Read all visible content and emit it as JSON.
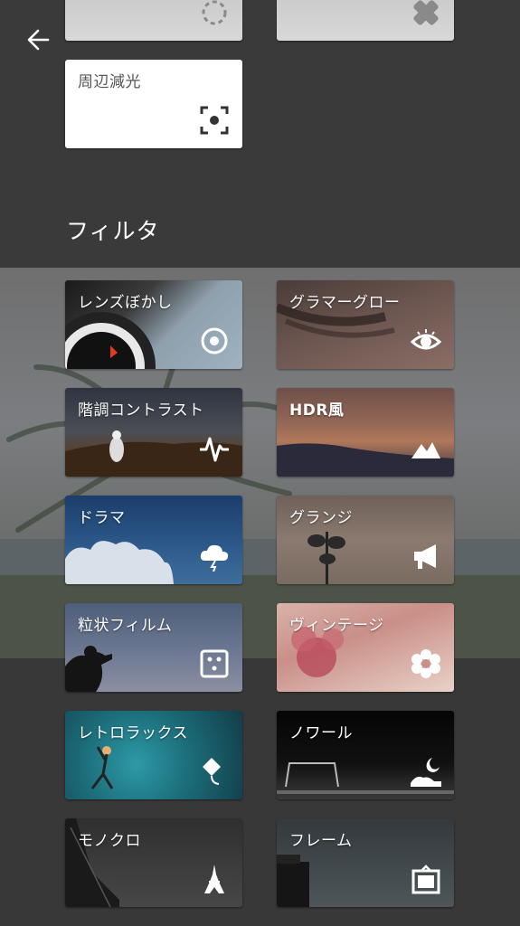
{
  "header": {
    "back_icon": "arrow-left-icon"
  },
  "tools_partial": [
    {
      "icon": "dashed-circle-icon"
    },
    {
      "icon": "healing-bandage-icon"
    }
  ],
  "vignette_tool": {
    "label": "周辺減光",
    "icon": "vignette-focus-icon"
  },
  "section": {
    "title": "フィルタ"
  },
  "filters": [
    {
      "label": "レンズぼかし",
      "icon": "target-circle-icon"
    },
    {
      "label": "グラマーグロー",
      "icon": "eye-icon"
    },
    {
      "label": "階調コントラスト",
      "icon": "pulse-icon"
    },
    {
      "label": "HDR風",
      "icon": "mountains-icon"
    },
    {
      "label": "ドラマ",
      "icon": "storm-cloud-icon"
    },
    {
      "label": "グランジ",
      "icon": "megaphone-icon"
    },
    {
      "label": "粒状フィルム",
      "icon": "dice-icon"
    },
    {
      "label": "ヴィンテージ",
      "icon": "flower-icon"
    },
    {
      "label": "レトロラックス",
      "icon": "kite-icon"
    },
    {
      "label": "ノワール",
      "icon": "moon-landscape-icon"
    },
    {
      "label": "モノクロ",
      "icon": "eiffel-tower-icon"
    },
    {
      "label": "フレーム",
      "icon": "frame-icon"
    }
  ]
}
